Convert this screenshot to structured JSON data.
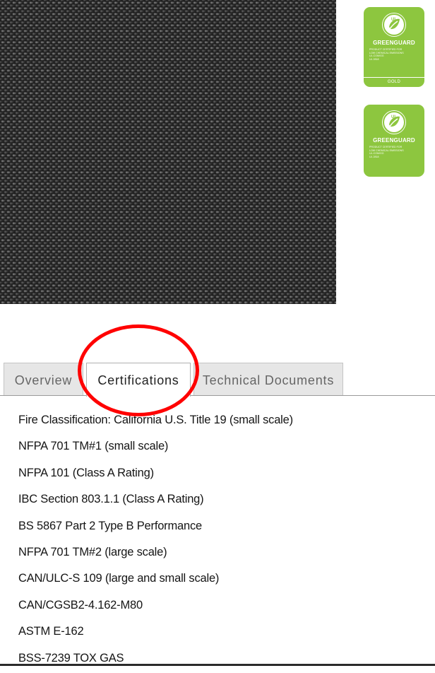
{
  "swatch": {
    "alt": "fabric-swatch"
  },
  "badges": [
    {
      "brand": "GREENGUARD",
      "mark": "UL",
      "fine_lines": [
        "PRODUCT CERTIFIED FOR",
        "LOW CHEMICAL EMISSIONS",
        "UL.COM/GG",
        "UL 2818"
      ],
      "tier": "GOLD"
    },
    {
      "brand": "GREENGUARD",
      "mark": "UL",
      "fine_lines": [
        "PRODUCT CERTIFIED FOR",
        "LOW CHEMICAL EMISSIONS",
        "UL.COM/GG",
        "UL 2818"
      ],
      "tier": ""
    }
  ],
  "colors": {
    "badge_green": "#8dc63f",
    "highlight_red": "#ff0000",
    "tab_inactive_bg": "#e6e6e6"
  },
  "tabs": [
    {
      "label": "Overview",
      "active": false
    },
    {
      "label": "Certifications",
      "active": true
    },
    {
      "label": "Technical Documents",
      "active": false
    }
  ],
  "certifications": [
    "Fire Classification: California U.S. Title 19 (small scale)",
    "NFPA 701 TM#1 (small scale)",
    "NFPA 101 (Class A Rating)",
    "IBC Section 803.1.1 (Class A Rating)",
    "BS 5867 Part 2 Type B Performance",
    "NFPA 701 TM#2 (large scale)",
    "CAN/ULC-S 109 (large and small scale)",
    "CAN/CGSB2-4.162-M80",
    "ASTM E-162",
    "BSS-7239 TOX GAS"
  ]
}
